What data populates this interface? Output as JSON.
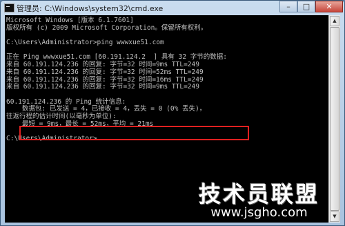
{
  "window": {
    "title": "管理员: C:\\Windows\\system32\\cmd.exe",
    "controls": {
      "minimize": "–",
      "maximize": "□",
      "close": "✕"
    }
  },
  "console": {
    "lines": [
      "Microsoft Windows [版本 6.1.7601]",
      "版权所有 (c) 2009 Microsoft Corporation。保留所有权利。",
      "",
      "C:\\Users\\Administrator>ping wwwxue51.com",
      "",
      "正在 Ping wwwxue51.com [60.191.124.2  ] 具有 32 字节的数据:",
      "来自 60.191.124.236 的回复: 字节=32 时间=9ms TTL=249",
      "来自 60.191.124.236 的回复: 字节=32 时间=52ms TTL=249",
      "来自 60.191.124.236 的回复: 字节=32 时间=16ms TTL=249",
      "来自 60.191.124.236 的回复: 字节=32 时间=9ms TTL=249",
      "",
      "60.191.124.236 的 Ping 统计信息:",
      "    数据包: 已发送 = 4，已接收 = 4，丢失 = 0 (0% 丢失)，",
      "往返行程的估计时间(以毫秒为单位):",
      "    最短 = 9ms，最长 = 52ms，平均 = 21ms",
      "",
      "C:\\Users\\Administrator>"
    ]
  },
  "watermark": {
    "main": "技术员联盟",
    "url": "www.jsgho.com"
  },
  "colors": {
    "console_bg": "#000000",
    "console_text": "#c0c0c0",
    "highlight_border": "#e02020"
  }
}
